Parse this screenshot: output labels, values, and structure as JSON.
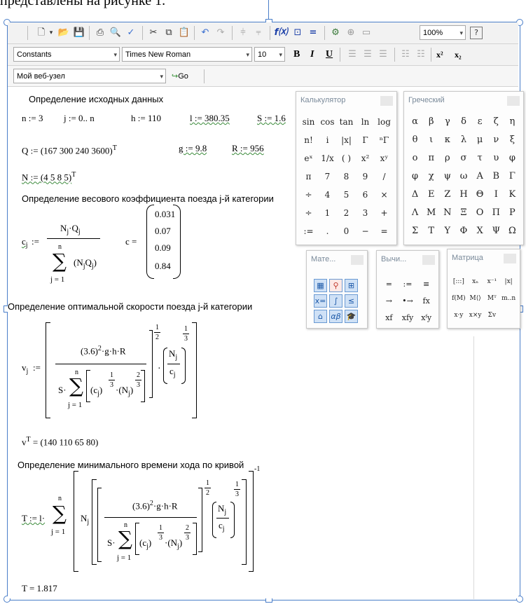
{
  "caption": "представлены на рисунке 1.",
  "toolbar1": {
    "zoom": "100%",
    "icons": [
      "new-doc",
      "dropdown",
      "open",
      "save",
      "print",
      "print-preview",
      "spell-check",
      "cut",
      "copy",
      "paste",
      "undo",
      "redo",
      "insert-unit",
      "align",
      "resource",
      "insert-function",
      "equals",
      "component",
      "insert-matrix",
      "insert-region",
      "help"
    ]
  },
  "toolbar2": {
    "style": "Constants",
    "font": "Times New Roman",
    "size": "10",
    "bold": "B",
    "italic": "I",
    "underline": "U",
    "superscript": "x²",
    "subscript": "x₂"
  },
  "toolbar3": {
    "address": "Мой веб-узел",
    "go": "Go"
  },
  "worksheet": {
    "heading1": "Определение исходных данных",
    "n_def": "n := 3",
    "j_def": "j := 0.. n",
    "h_def": "h := 110",
    "l_def": "l := 380.35",
    "S_def": "S := 1.6",
    "Q_def": "Q := (167  300  240  3600)",
    "T_sup": "T",
    "g_def": "g := 9.8",
    "R_def": "R := 956",
    "N_def": "N := (4  5  8  5)",
    "heading2": "Определение весового коэффициента поезда  j-й категории",
    "c_lhs": "c",
    "c_sub": "j",
    "assign": ":=",
    "c_num": "N",
    "c_num_sub1": "j",
    "c_num_mid": "·Q",
    "c_num_sub2": "j",
    "sum_top": "n",
    "sum_bottom": "j = 1",
    "c_den_term": "(N",
    "c_den_term2": "Q",
    "c_den_close": ")",
    "c_eval_lhs": "c =",
    "c_values": [
      "0.031",
      "0.07",
      "0.09",
      "0.84"
    ],
    "heading3": "Определение оптимальной скорости поезда  j-й категории",
    "v_lhs": "v",
    "v_sub": "j",
    "v_num": "(3.6)",
    "v_num_pow": "2",
    "v_num_rest": "·g·h·R",
    "v_den_S": "S·",
    "exp_1": "1",
    "exp_2": "2",
    "exp_3": "3",
    "ratio_num": "N",
    "ratio_den": "c",
    "v_result_lhs": "v",
    "v_result_sup": "T",
    "v_result": "= (140  110  65  80)",
    "heading4": "Определение минимального времени хода по кривой",
    "T_lhs": "T := l·",
    "T_pow": "-1",
    "T_result": "T = 1.817"
  },
  "panels": {
    "calculator": {
      "title": "Калькулятор",
      "rows": [
        [
          "sin",
          "cos",
          "tan",
          "ln",
          "log"
        ],
        [
          "n!",
          "i",
          "|x|",
          "Γ",
          "ⁿΓ"
        ],
        [
          "eˣ",
          "1/x",
          "( )",
          "x²",
          "xʸ"
        ],
        [
          "π",
          "7",
          "8",
          "9",
          "/"
        ],
        [
          "÷",
          "4",
          "5",
          "6",
          "×"
        ],
        [
          "÷",
          "1",
          "2",
          "3",
          "+"
        ],
        [
          ":=",
          ".",
          "0",
          "−",
          "="
        ]
      ]
    },
    "greek": {
      "title": "Греческий",
      "rows": [
        [
          "α",
          "β",
          "γ",
          "δ",
          "ε",
          "ζ",
          "η"
        ],
        [
          "θ",
          "ι",
          "κ",
          "λ",
          "μ",
          "ν",
          "ξ"
        ],
        [
          "ο",
          "π",
          "ρ",
          "σ",
          "τ",
          "υ",
          "φ"
        ],
        [
          "φ",
          "χ",
          "ψ",
          "ω",
          "Α",
          "Β",
          "Γ"
        ],
        [
          "Δ",
          "Ε",
          "Ζ",
          "Η",
          "Θ",
          "Ι",
          "Κ"
        ],
        [
          "Λ",
          "Μ",
          "Ν",
          "Ξ",
          "Ο",
          "Π",
          "Ρ"
        ],
        [
          "Σ",
          "Τ",
          "Υ",
          "Φ",
          "Χ",
          "Ψ",
          "Ω"
        ]
      ]
    },
    "math": {
      "title": "Мате...",
      "icons": [
        "calculator-toolbar",
        "graph-toolbar",
        "matrix-toolbar",
        "evaluation-toolbar",
        "calculus-toolbar",
        "boolean-toolbar",
        "programming-toolbar",
        "greek-toolbar",
        "symbolic-toolbar"
      ]
    },
    "evaluation": {
      "title": "Вычи...",
      "rows": [
        [
          "=",
          ":=",
          "≡"
        ],
        [
          "→",
          "•→",
          "fx"
        ],
        [
          "xf",
          "xfy",
          "xᶠy"
        ]
      ]
    },
    "matrix": {
      "title": "Матрица",
      "rows": [
        [
          "[:::]",
          "xₙ",
          "x⁻¹",
          "|x|"
        ],
        [
          "f(M)",
          "M⟨⟩",
          "Mᵀ",
          "m..n"
        ],
        [
          "x·y",
          "x×y",
          "Σv",
          ""
        ]
      ]
    }
  }
}
